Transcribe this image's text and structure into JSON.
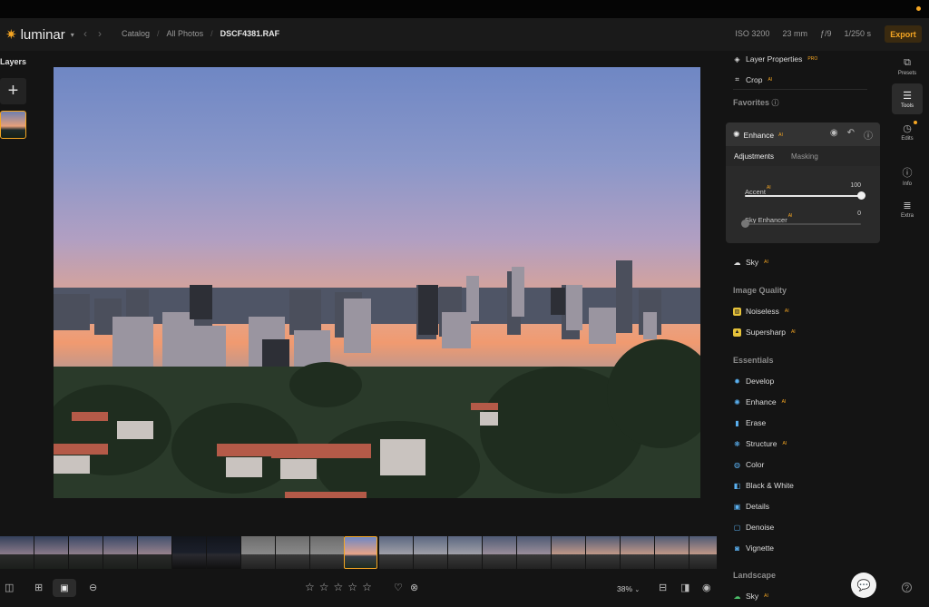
{
  "header": {
    "app_name": "luminar",
    "breadcrumb": [
      "Catalog",
      "All Photos",
      "DSCF4381.RAF"
    ],
    "exif": {
      "iso": "ISO 3200",
      "focal": "23 mm",
      "aperture": "ƒ/9",
      "shutter": "1/250 s"
    },
    "export_label": "Export"
  },
  "left_panel": {
    "title": "Layers",
    "add_symbol": "+"
  },
  "right_panel": {
    "layer_properties": "Layer Properties",
    "pro_badge": "PRO",
    "crop": "Crop",
    "ai_badge": "AI",
    "favorites": "Favorites",
    "enhance": {
      "title": "Enhance",
      "tabs": [
        "Adjustments",
        "Masking"
      ],
      "sliders": [
        {
          "label": "Accent",
          "value": "100",
          "fraction": 1.0
        },
        {
          "label": "Sky Enhancer",
          "value": "0",
          "fraction": 0.0
        }
      ]
    },
    "sky": "Sky",
    "image_quality_title": "Image Quality",
    "image_quality_items": [
      "Noiseless",
      "Supersharp"
    ],
    "essentials_title": "Essentials",
    "essentials_items": [
      "Develop",
      "Enhance",
      "Erase",
      "Structure",
      "Color",
      "Black & White",
      "Details",
      "Denoise",
      "Vignette"
    ],
    "landscape_title": "Landscape",
    "landscape_items": [
      "Sky"
    ]
  },
  "far_right": {
    "buttons": [
      "Presets",
      "Tools",
      "Edits",
      "Info",
      "Extra"
    ]
  },
  "bottom": {
    "zoom": "38%"
  },
  "colors": {
    "accent": "#f5a623",
    "background": "#141414",
    "panel": "#2a2a2a"
  }
}
